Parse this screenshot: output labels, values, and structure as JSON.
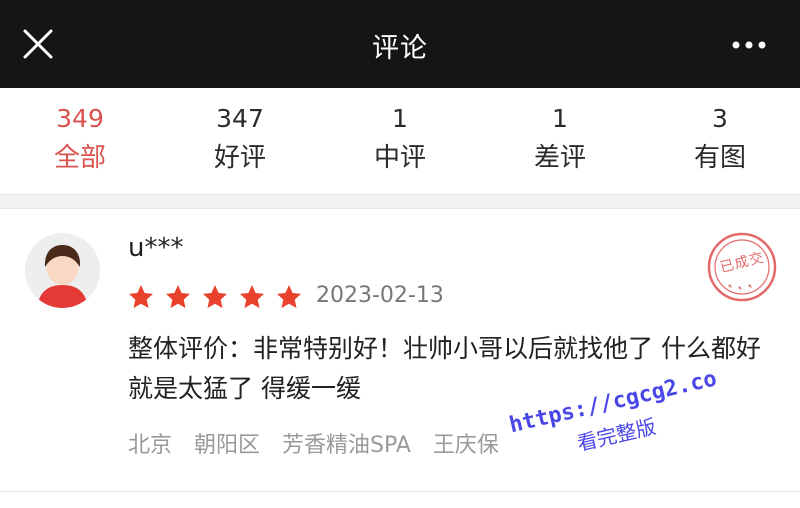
{
  "header": {
    "title": "评论",
    "close_icon": "close-icon",
    "more_icon": "more-horizontal-icon",
    "background": "#151515"
  },
  "tabs": [
    {
      "count": "349",
      "label": "全部",
      "active": true
    },
    {
      "count": "347",
      "label": "好评",
      "active": false
    },
    {
      "count": "1",
      "label": "中评",
      "active": false
    },
    {
      "count": "1",
      "label": "差评",
      "active": false
    },
    {
      "count": "3",
      "label": "有图",
      "active": false
    }
  ],
  "colors": {
    "accent": "#d9534f",
    "star": "#e8412c",
    "watermark": "#4a47e8"
  },
  "review": {
    "username": "u***",
    "rating": 5,
    "rating_max": 5,
    "date": "2023-02-13",
    "stamp_text": "已成交",
    "content": "整体评价：非常特别好！壮帅小哥以后就找他了 什么都好就是太猛了 得缓一缓",
    "tags": [
      "北京",
      "朝阳区",
      "芳香精油SPA",
      "王庆保"
    ]
  },
  "watermark": {
    "url": "https://cgcg2.co",
    "text": "看完整版"
  }
}
